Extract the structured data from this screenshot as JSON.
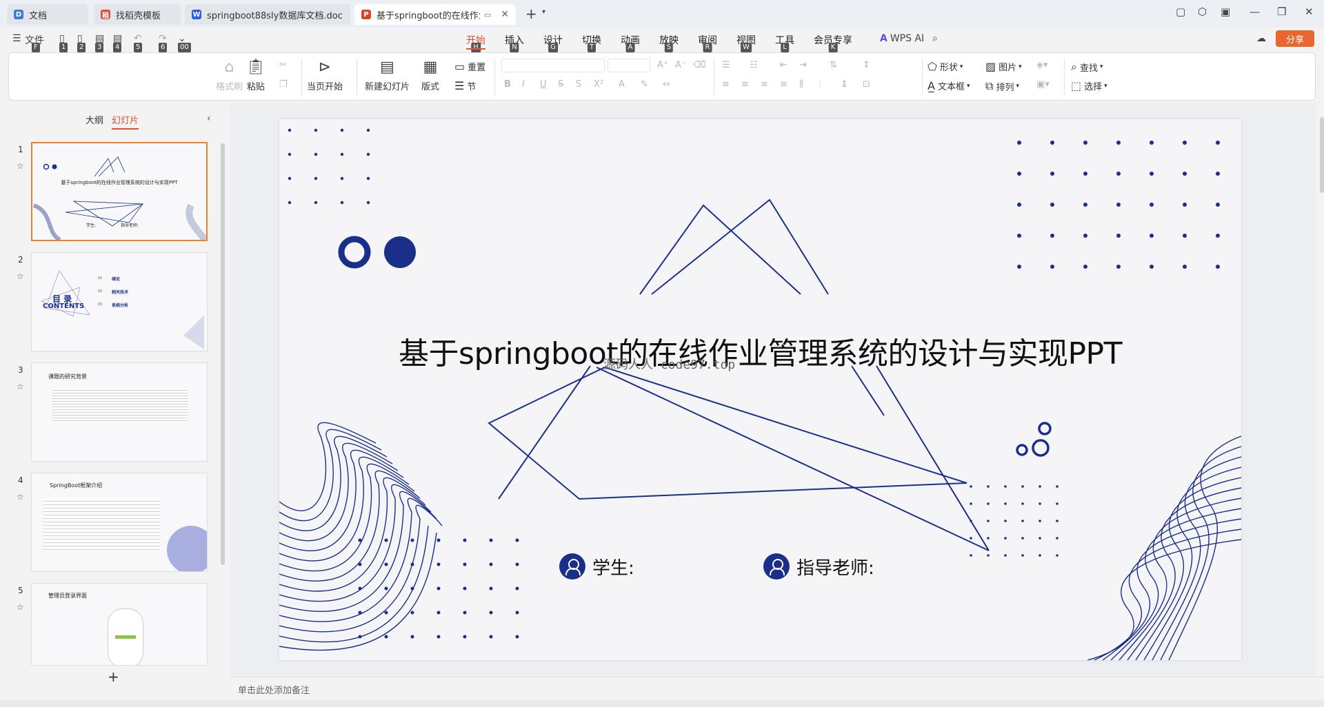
{
  "tabs": [
    {
      "label": "文档",
      "icon": "docs-app-icon",
      "color": "#3d7bd8"
    },
    {
      "label": "找稻壳模板",
      "icon": "docer-icon",
      "color": "#e04a3c"
    },
    {
      "label": "springboot88sly数据库文档.doc",
      "icon": "word-icon",
      "color": "#2b5fd9"
    },
    {
      "label": "基于springboot的在线作业",
      "icon": "ppt-icon",
      "color": "#d24726"
    }
  ],
  "menu": {
    "file": "文件",
    "items": [
      {
        "label": "开始",
        "key": "H"
      },
      {
        "label": "插入",
        "key": "N"
      },
      {
        "label": "设计",
        "key": "G"
      },
      {
        "label": "切换",
        "key": "T"
      },
      {
        "label": "动画",
        "key": "A"
      },
      {
        "label": "放映",
        "key": "S"
      },
      {
        "label": "审阅",
        "key": "R"
      },
      {
        "label": "视图",
        "key": "W"
      },
      {
        "label": "工具",
        "key": "L"
      },
      {
        "label": "会员专享",
        "key": "K"
      }
    ],
    "quick_keys": [
      "F",
      "1",
      "2",
      "3",
      "4",
      "5",
      "6",
      "00"
    ],
    "wps_ai": "WPS AI",
    "share": "分享"
  },
  "ribbon": {
    "format_painter": "格式刷",
    "paste": "粘贴",
    "play_current": "当页开始",
    "new_slide": "新建幻灯片",
    "layout": "版式",
    "reset": "重置",
    "section": "节",
    "shape": "形状",
    "picture": "图片",
    "textbox": "文本框",
    "arrange": "排列",
    "find": "查找",
    "select": "选择"
  },
  "panel": {
    "outline": "大纲",
    "slides": "幻灯片",
    "add_slide": "+"
  },
  "thumbnails": [
    {
      "num": "1",
      "title": "基于springboot的在线作业管理系统的设计与实现PPT",
      "student": "学生:",
      "teacher": "指导老师:"
    },
    {
      "num": "2",
      "toc_title": "目 录",
      "toc_sub": "CONTENTS",
      "items": [
        {
          "n": "01",
          "t": "绪论"
        },
        {
          "n": "02",
          "t": "相关技术"
        },
        {
          "n": "03",
          "t": "系统分析"
        }
      ]
    },
    {
      "num": "3",
      "title": "课题的研究背景"
    },
    {
      "num": "4",
      "title": "SpringBoot框架介绍"
    },
    {
      "num": "5",
      "title": "管理员登录界面"
    }
  ],
  "slide": {
    "title": "基于springboot的在线作业管理系统的设计与实现PPT",
    "watermark": "源码人人 code97.top",
    "student_label": "学生:",
    "teacher_label": "指导老师:",
    "accent": "#1a2f8a"
  },
  "notes_placeholder": "单击此处添加备注"
}
